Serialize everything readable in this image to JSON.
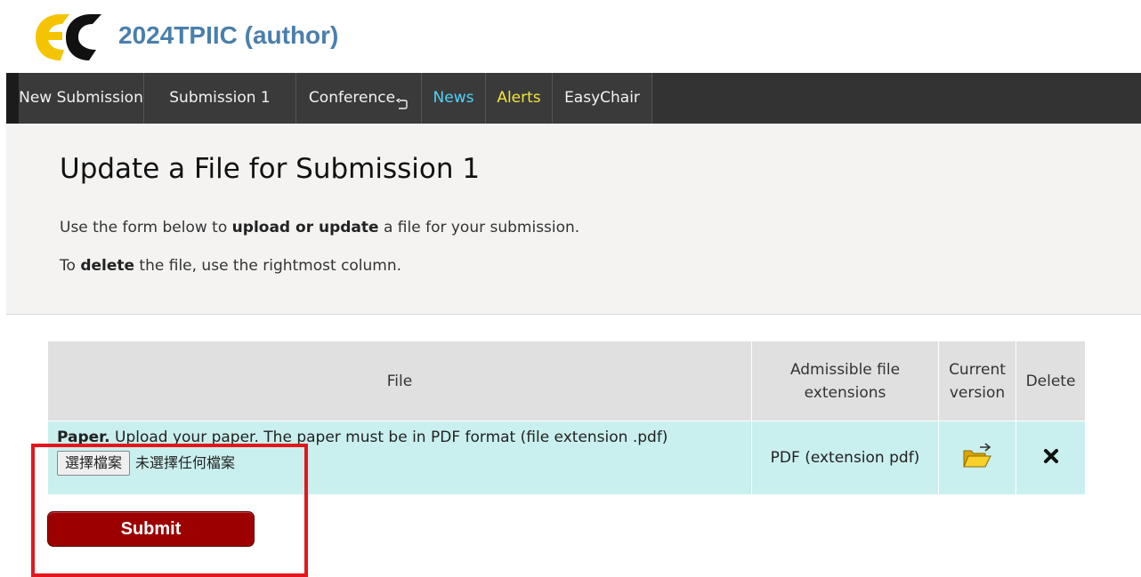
{
  "header": {
    "title": "2024TPIIC (author)",
    "logo_icon": "easychair-logo-icon",
    "title_color": "#4a7fab"
  },
  "menu": {
    "items": [
      {
        "label": "New Submission",
        "color": "#f2f2f2"
      },
      {
        "label": "Submission 1",
        "color": "#f2f2f2"
      },
      {
        "label": "Conference",
        "color": "#f2f2f2",
        "icon": "return-arrow-icon"
      },
      {
        "label": "News",
        "color": "#4fd3f7"
      },
      {
        "label": "Alerts",
        "color": "#f2e63b"
      },
      {
        "label": "EasyChair",
        "color": "#f2f2f2"
      }
    ]
  },
  "panel": {
    "title": "Update a File for Submission 1",
    "line1": {
      "pre": "Use the form below to ",
      "bold": "upload or update",
      "post": " a file for your submission."
    },
    "line2": {
      "pre": "To ",
      "bold": "delete",
      "post": " the file, use the rightmost column."
    }
  },
  "table": {
    "headers": {
      "file": "File",
      "admissible": "Admissible file extensions",
      "current": "Current version",
      "delete": "Delete"
    },
    "rows": [
      {
        "name": "Paper.",
        "description": "Upload your paper. The paper must be in PDF format (file extension .pdf)",
        "choose_button": "選擇檔案",
        "no_file_text": "未選擇任何檔案",
        "extensions": "PDF (extension pdf)",
        "current_icon": "open-folder-icon",
        "delete_icon": "delete-x-icon"
      }
    ]
  },
  "form": {
    "submit_label": "Submit"
  },
  "colors": {
    "menubar": "#333333",
    "panel_bg": "#f4f3f2",
    "table_header_bg": "#e0e0e0",
    "table_row_bg": "#c9f0ee",
    "submit_bg": "#9c0000",
    "highlight": "#e4161c"
  }
}
